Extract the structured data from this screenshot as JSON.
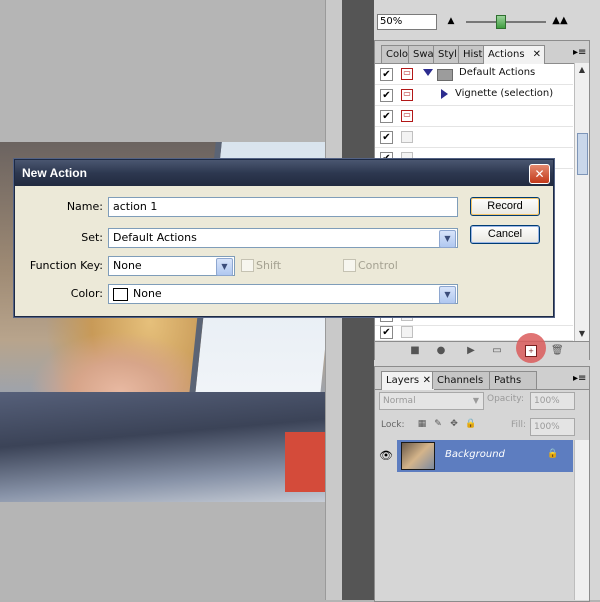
{
  "navigator": {
    "zoom_value": "50%",
    "zoom_out_icon": "small-mountain-icon",
    "zoom_in_icon": "large-mountain-icon"
  },
  "actions_panel": {
    "tabs": [
      "Colo",
      "Swa",
      "Styl",
      "Hist",
      "Actions"
    ],
    "active_tab": "Actions",
    "rows": [
      {
        "checked": true,
        "dialog": true,
        "label": "Default Actions",
        "type": "set"
      },
      {
        "checked": true,
        "dialog": true,
        "label": "Vignette (selection)",
        "type": "action"
      },
      {
        "checked": true,
        "dialog": true,
        "label": "",
        "type": "empty"
      },
      {
        "checked": true,
        "dialog": false,
        "label": "",
        "type": "empty"
      }
    ],
    "footer_icons": [
      "stop-icon",
      "record-icon",
      "play-icon",
      "new-set-icon",
      "new-action-icon",
      "trash-icon"
    ]
  },
  "layers_panel": {
    "tabs": [
      "Layers",
      "Channels",
      "Paths"
    ],
    "active_tab": "Layers",
    "blend_mode": "Normal",
    "opacity_label": "Opacity:",
    "opacity_value": "100%",
    "lock_label": "Lock:",
    "fill_label": "Fill:",
    "fill_value": "100%",
    "layer_name": "Background"
  },
  "dialog": {
    "title": "New Action",
    "name_label": "Name:",
    "name_value": "action 1",
    "set_label": "Set:",
    "set_value": "Default Actions",
    "function_key_label": "Function Key:",
    "function_key_value": "None",
    "shift_label": "Shift",
    "control_label": "Control",
    "color_label": "Color:",
    "color_value": "None",
    "record_label": "Record",
    "cancel_label": "Cancel"
  },
  "colors": {
    "dialog_title_bg": "#2d3850",
    "layer_selected": "#5d7dc0",
    "highlight": "#db5c5c",
    "close_red": "#c2391a"
  }
}
